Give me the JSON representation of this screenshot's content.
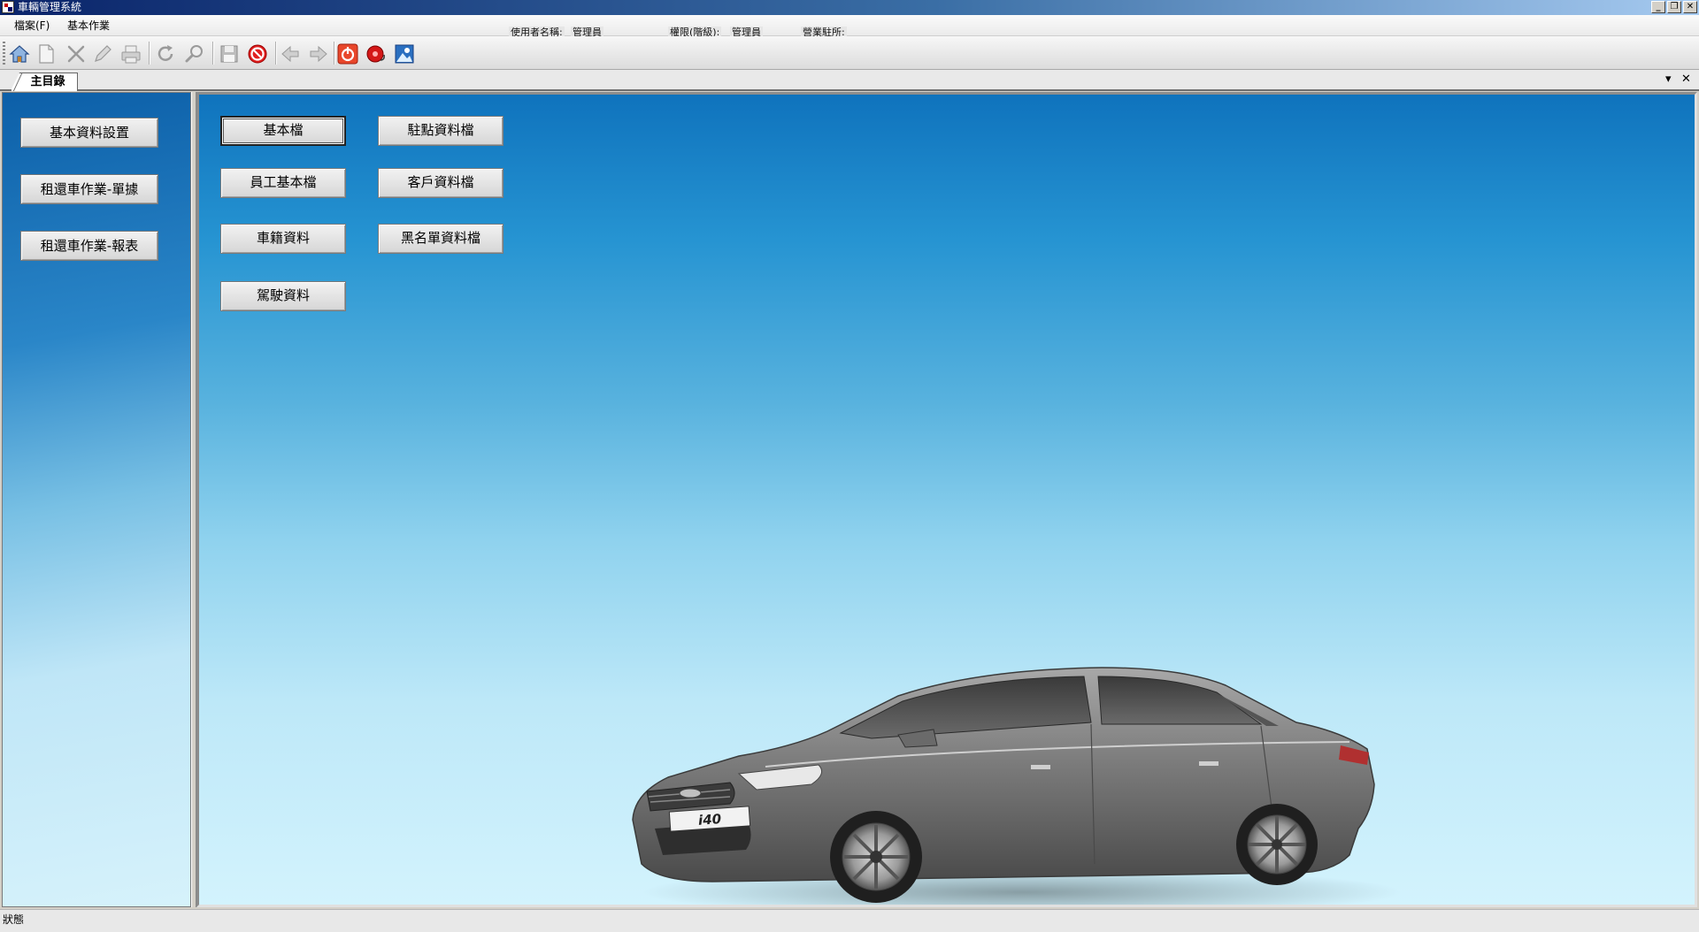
{
  "window": {
    "title": "車輛管理系統",
    "controls": {
      "minimize": "_",
      "restore": "❐",
      "close": "✕"
    }
  },
  "menu": {
    "items": [
      "檔案(F)",
      "基本作業"
    ]
  },
  "user_info": {
    "username_label": "使用者名稱:",
    "username_value": "管理員",
    "permission_label": "權限(階級):",
    "permission_value": "管理員",
    "branch_label": "營業駐所:"
  },
  "toolbar": {
    "icons": [
      "home-icon",
      "new-document-icon",
      "delete-icon",
      "edit-icon",
      "print-icon",
      "refresh-icon",
      "search-icon",
      "save-icon",
      "stop-icon",
      "previous-icon",
      "next-icon",
      "power-icon",
      "alarm-icon",
      "picture-icon"
    ]
  },
  "tabs": {
    "active": "主目錄",
    "dropdown_glyph": "▾",
    "close_glyph": "✕"
  },
  "sidebar": {
    "items": [
      "基本資料設置",
      "租還車作業-單據",
      "租還車作業-報表"
    ]
  },
  "main": {
    "buttons": {
      "basic": "基本檔",
      "station": "駐點資料檔",
      "employee": "員工基本檔",
      "customer": "客戶資料檔",
      "vehicle": "車籍資料",
      "blacklist": "黑名單資料檔",
      "driver": "駕駛資料"
    },
    "car_badge": "i40"
  },
  "status": {
    "text": "狀態"
  },
  "colors": {
    "title_bar": "#0a246a",
    "accent_blue": "#1e88cf",
    "stop_red": "#e02020"
  }
}
